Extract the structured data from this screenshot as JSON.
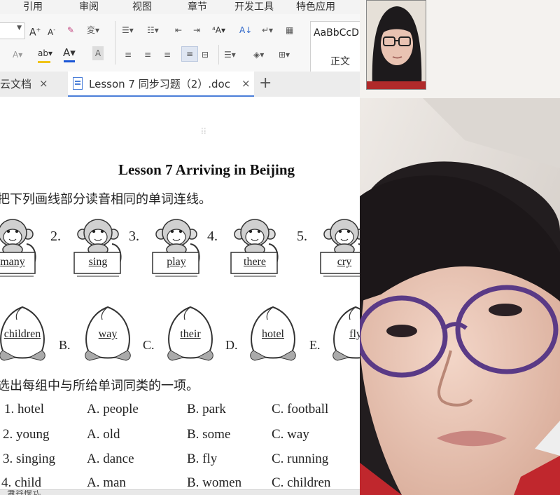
{
  "menu": {
    "items": [
      "引用",
      "审阅",
      "视图",
      "章节",
      "开发工具",
      "特色应用"
    ]
  },
  "ribbon": {
    "style_preview_text": "AaBbCcD",
    "style_name": "正文"
  },
  "tabs": {
    "first_label": "云文档",
    "doc_label": "Lesson 7 同步习题（2）.doc"
  },
  "document": {
    "title": "Lesson 7 Arriving in Beijing",
    "instruction1": "把下列画线部分读音相同的单词连线。",
    "monkeys": [
      {
        "num": "",
        "word": "many"
      },
      {
        "num": "2.",
        "word": "sing"
      },
      {
        "num": "3.",
        "word": "play"
      },
      {
        "num": "4.",
        "word": "there"
      },
      {
        "num": "5.",
        "word": "cry"
      }
    ],
    "peaches": [
      {
        "letter": "",
        "word": "children"
      },
      {
        "letter": "B.",
        "word": "way"
      },
      {
        "letter": "C.",
        "word": "their"
      },
      {
        "letter": "D.",
        "word": "hotel"
      },
      {
        "letter": "E.",
        "word": "fly"
      }
    ],
    "instruction2": "选出每组中与所给单词同类的一项。",
    "exercises": [
      {
        "q": "1. hotel",
        "a": "A. people",
        "b": "B. park",
        "c": "C. football"
      },
      {
        "q": "2. young",
        "a": "A. old",
        "b": "B. some",
        "c": "C. way"
      },
      {
        "q": "3. singing",
        "a": "A. dance",
        "b": "B. fly",
        "c": "C. running"
      },
      {
        "q": "4. child",
        "a": "A. man",
        "b": "B. women",
        "c": "C. children"
      }
    ]
  },
  "status": {
    "mode": "兼容模式"
  },
  "colors": {
    "accent": "#4a7ed8",
    "font_color_underline": "#1a56d6",
    "highlight_underline": "#f0c419"
  }
}
